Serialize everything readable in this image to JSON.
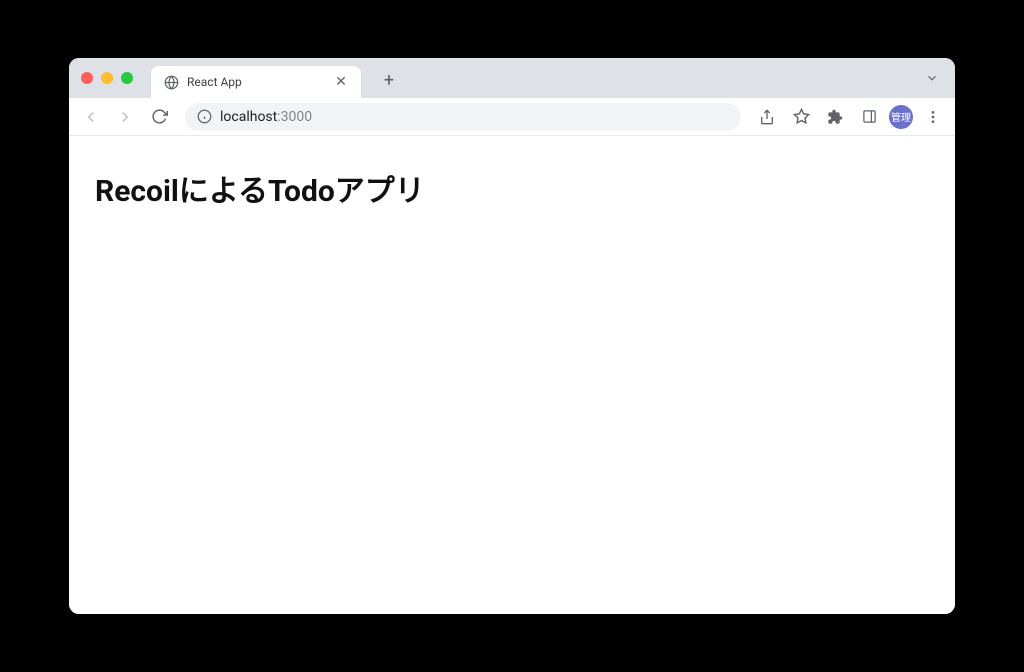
{
  "browser": {
    "tab": {
      "title": "React App"
    },
    "url": {
      "host": "localhost",
      "port": ":3000"
    },
    "avatar_label": "管理"
  },
  "page": {
    "heading": "RecoilによるTodoアプリ"
  }
}
